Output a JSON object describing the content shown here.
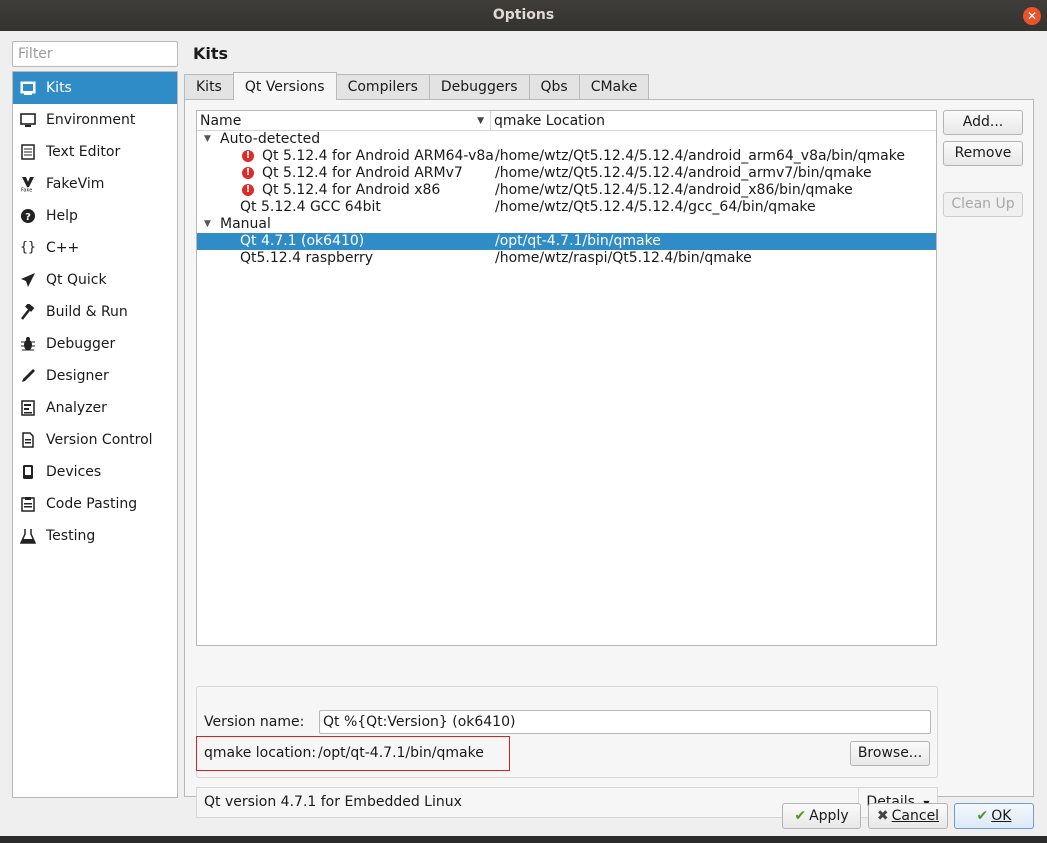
{
  "window": {
    "title": "Options"
  },
  "filter": {
    "placeholder": "Filter"
  },
  "sidebar": {
    "items": [
      {
        "label": "Kits",
        "icon": "kits-icon"
      },
      {
        "label": "Environment",
        "icon": "monitor-icon"
      },
      {
        "label": "Text Editor",
        "icon": "text-editor-icon"
      },
      {
        "label": "FakeVim",
        "icon": "fakevim-icon"
      },
      {
        "label": "Help",
        "icon": "help-icon"
      },
      {
        "label": "C++",
        "icon": "braces-icon"
      },
      {
        "label": "Qt Quick",
        "icon": "paper-plane-icon"
      },
      {
        "label": "Build & Run",
        "icon": "hammer-icon"
      },
      {
        "label": "Debugger",
        "icon": "bug-icon"
      },
      {
        "label": "Designer",
        "icon": "pen-icon"
      },
      {
        "label": "Analyzer",
        "icon": "analyzer-icon"
      },
      {
        "label": "Version Control",
        "icon": "document-icon"
      },
      {
        "label": "Devices",
        "icon": "device-icon"
      },
      {
        "label": "Code Pasting",
        "icon": "clipboard-icon"
      },
      {
        "label": "Testing",
        "icon": "flask-icon"
      }
    ],
    "selected": "Kits"
  },
  "page": {
    "title": "Kits"
  },
  "tabs": [
    "Kits",
    "Qt Versions",
    "Compilers",
    "Debuggers",
    "Qbs",
    "CMake"
  ],
  "active_tab": "Qt Versions",
  "tree": {
    "columns": {
      "name": "Name",
      "location": "qmake Location"
    },
    "groups": {
      "auto": "Auto-detected",
      "manual": "Manual"
    },
    "rows": [
      {
        "name": "Qt 5.12.4 for Android ARM64-v8a",
        "location": "/home/wtz/Qt5.12.4/5.12.4/android_arm64_v8a/bin/qmake",
        "warning": true
      },
      {
        "name": "Qt 5.12.4 for Android ARMv7",
        "location": "/home/wtz/Qt5.12.4/5.12.4/android_armv7/bin/qmake",
        "warning": true
      },
      {
        "name": "Qt 5.12.4 for Android x86",
        "location": "/home/wtz/Qt5.12.4/5.12.4/android_x86/bin/qmake",
        "warning": true
      },
      {
        "name": "Qt 5.12.4 GCC 64bit",
        "location": "/home/wtz/Qt5.12.4/5.12.4/gcc_64/bin/qmake",
        "warning": false
      },
      {
        "name": "Qt 4.7.1 (ok6410)",
        "location": "/opt/qt-4.7.1/bin/qmake",
        "selected": true
      },
      {
        "name": "Qt5.12.4 raspberry",
        "location": "/home/wtz/raspi/Qt5.12.4/bin/qmake"
      }
    ]
  },
  "buttons": {
    "add": "Add...",
    "remove": "Remove",
    "cleanup": "Clean Up",
    "browse": "Browse...",
    "details": "Details",
    "apply": "Apply",
    "cancel": "Cancel",
    "ok": "OK"
  },
  "details": {
    "version_name_label": "Version name:",
    "version_name_value": "Qt %{Qt:Version} (ok6410)",
    "qmake_label": "qmake location:",
    "qmake_value": "/opt/qt-4.7.1/bin/qmake",
    "info": "Qt version 4.7.1 for Embedded Linux"
  },
  "colors": {
    "selection": "#308cc6",
    "warning": "#dd2a2a",
    "highlight_box": "#e02020"
  }
}
